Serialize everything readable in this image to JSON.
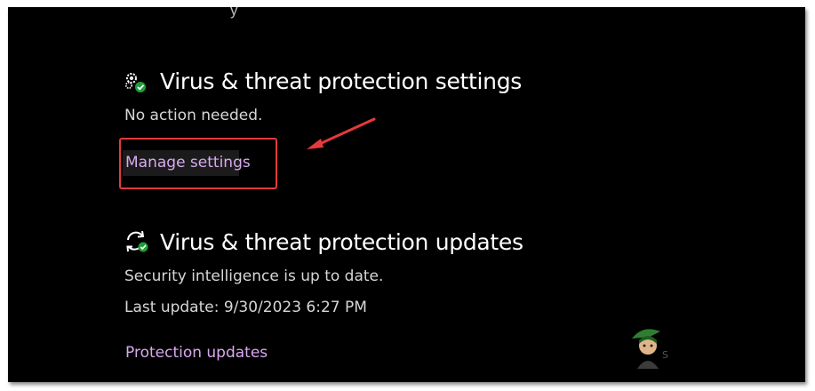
{
  "top_partial_text": "y",
  "sections": [
    {
      "title": "Virus & threat protection settings",
      "icon": "settings-gear-check-icon",
      "status": "No action needed.",
      "link": "Manage settings"
    },
    {
      "title": "Virus & threat protection updates",
      "icon": "refresh-check-icon",
      "status": "Security intelligence is up to date.",
      "last_update": "Last update: 9/30/2023 6:27 PM",
      "link": "Protection updates"
    }
  ],
  "annotation": {
    "color": "#e53a3a",
    "target": "Manage settings"
  },
  "colors": {
    "background": "#000000",
    "text": "#ffffff",
    "link": "#d9a9f0",
    "status_ok": "#1e9e3a"
  }
}
